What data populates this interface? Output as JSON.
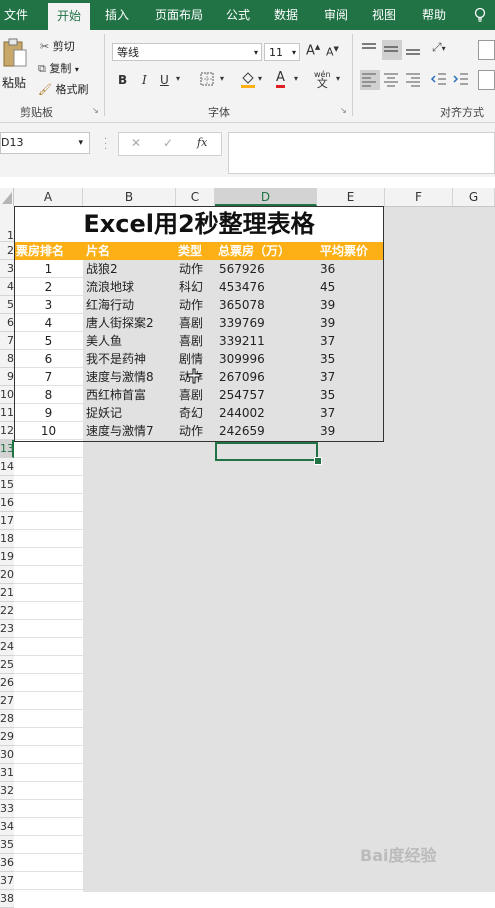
{
  "tabs": [
    "文件",
    "开始",
    "插入",
    "页面布局",
    "公式",
    "数据",
    "审阅",
    "视图",
    "帮助"
  ],
  "ribbon": {
    "paste": "粘贴",
    "cut": "剪切",
    "copy": "复制",
    "format_painter": "格式刷",
    "clipboard_group": "剪贴板",
    "font_name": "等线",
    "font_size": "11",
    "bold": "B",
    "italic": "I",
    "underline": "U",
    "font_group": "字体",
    "align_group": "对齐方式",
    "grow_font": "A",
    "shrink_font": "A",
    "font_color_letter": "A",
    "wen_top": "wén",
    "wen_char": "文"
  },
  "formula_bar": {
    "name_box": "D13",
    "cancel": "✕",
    "enter": "✓",
    "fx": "fx",
    "content": ""
  },
  "columns": [
    "A",
    "B",
    "C",
    "D",
    "E",
    "F",
    "G"
  ],
  "rows": [
    "1",
    "2",
    "3",
    "4",
    "5",
    "6",
    "7",
    "8",
    "9",
    "10",
    "11",
    "12",
    "13",
    "14",
    "15",
    "16",
    "17",
    "18",
    "19",
    "20",
    "21",
    "22",
    "23",
    "24",
    "25",
    "26",
    "27",
    "28",
    "29",
    "30",
    "31",
    "32",
    "33",
    "34",
    "35",
    "36",
    "37",
    "38"
  ],
  "sheet": {
    "title": "Excel用2秒整理表格",
    "headers": [
      "票房排名",
      "片名",
      "类型",
      "总票房（万）",
      "平均票价"
    ],
    "data": [
      [
        "1",
        "战狼2",
        "动作",
        "567926",
        "36"
      ],
      [
        "2",
        "流浪地球",
        "科幻",
        "453476",
        "45"
      ],
      [
        "3",
        "红海行动",
        "动作",
        "365078",
        "39"
      ],
      [
        "4",
        "唐人街探案2",
        "喜剧",
        "339769",
        "39"
      ],
      [
        "5",
        "美人鱼",
        "喜剧",
        "339211",
        "37"
      ],
      [
        "6",
        "我不是药神",
        "剧情",
        "309996",
        "35"
      ],
      [
        "7",
        "速度与激情8",
        "动作",
        "267096",
        "37"
      ],
      [
        "8",
        "西红柿首富",
        "喜剧",
        "254757",
        "35"
      ],
      [
        "9",
        "捉妖记",
        "奇幻",
        "244002",
        "37"
      ],
      [
        "10",
        "速度与激情7",
        "动作",
        "242659",
        "39"
      ]
    ]
  },
  "watermark": "Bai度经验",
  "colors": {
    "accent": "#217346",
    "header_fill": "#fcb016"
  }
}
